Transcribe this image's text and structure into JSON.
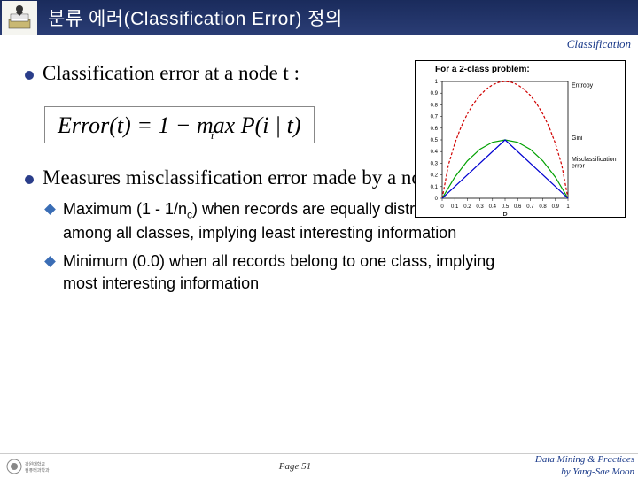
{
  "header": {
    "title": "분류 에러(Classification Error) 정의",
    "tag": "Classification"
  },
  "bullets": {
    "b1": "Classification error at a node t :",
    "b2": "Measures misclassification error made by a node."
  },
  "formula": {
    "lhs": "Error(t)",
    "eq": " = 1 − max ",
    "subscript": "i",
    "rhs": "P(i | t)"
  },
  "subs": {
    "s1a": "Maximum (1 - 1/n",
    "s1b": ") when records are equally distributed",
    "s1c": "among all classes, implying least interesting information",
    "s2a": "Minimum (0.0) when all records belong to one class, implying",
    "s2b": "most interesting information"
  },
  "chart_data": {
    "type": "line",
    "title": "For a 2-class problem:",
    "xlabel": "P",
    "ylabel": "",
    "xlim": [
      0,
      1
    ],
    "ylim": [
      0,
      1
    ],
    "xticks": [
      0,
      0.1,
      0.2,
      0.3,
      0.4,
      0.5,
      0.6,
      0.7,
      0.8,
      0.9,
      1
    ],
    "yticks": [
      0,
      0.1,
      0.2,
      0.3,
      0.4,
      0.5,
      0.6,
      0.7,
      0.8,
      0.9,
      1
    ],
    "series": [
      {
        "name": "Entropy",
        "color": "#d00000",
        "style": "dashed",
        "x": [
          0,
          0.05,
          0.1,
          0.15,
          0.2,
          0.25,
          0.3,
          0.35,
          0.4,
          0.45,
          0.5,
          0.55,
          0.6,
          0.65,
          0.7,
          0.75,
          0.8,
          0.85,
          0.9,
          0.95,
          1
        ],
        "y": [
          0,
          0.286,
          0.469,
          0.61,
          0.722,
          0.811,
          0.881,
          0.934,
          0.971,
          0.993,
          1.0,
          0.993,
          0.971,
          0.934,
          0.881,
          0.811,
          0.722,
          0.61,
          0.469,
          0.286,
          0
        ]
      },
      {
        "name": "Gini",
        "color": "#00a000",
        "style": "solid",
        "x": [
          0,
          0.1,
          0.2,
          0.3,
          0.4,
          0.5,
          0.6,
          0.7,
          0.8,
          0.9,
          1
        ],
        "y": [
          0,
          0.18,
          0.32,
          0.42,
          0.48,
          0.5,
          0.48,
          0.42,
          0.32,
          0.18,
          0
        ]
      },
      {
        "name": "Misclassification error",
        "color": "#0000d0",
        "style": "solid",
        "x": [
          0,
          0.5,
          1
        ],
        "y": [
          0,
          0.5,
          0
        ]
      }
    ],
    "legend": {
      "entropy": "Entropy",
      "gini": "Gini",
      "misc1": "Misclassification",
      "misc2": "error"
    }
  },
  "footer": {
    "page": "Page 51",
    "credit1": "Data Mining & Practices",
    "credit2": "by Yang-Sae Moon"
  }
}
